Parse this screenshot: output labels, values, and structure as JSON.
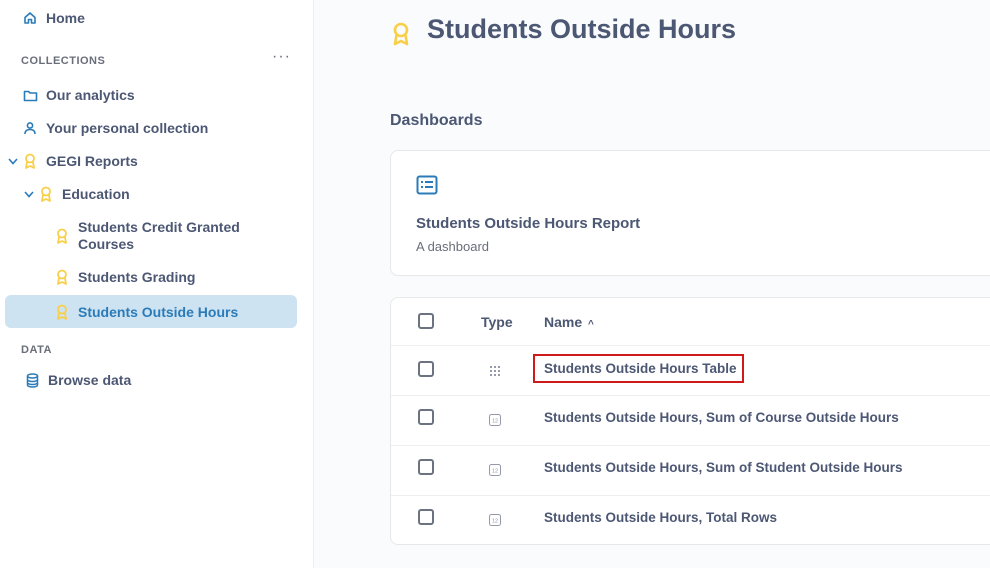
{
  "sidebar": {
    "home": "Home",
    "collections_label": "COLLECTIONS",
    "more": "···",
    "items": [
      {
        "label": "Our analytics"
      },
      {
        "label": "Your personal collection"
      },
      {
        "label": "GEGI Reports"
      },
      {
        "label": "Education"
      },
      {
        "label": "Students Credit Granted Courses"
      },
      {
        "label": "Students Grading"
      },
      {
        "label": "Students Outside Hours"
      }
    ],
    "data_label": "DATA",
    "browse_data": "Browse data"
  },
  "main": {
    "title": "Students Outside Hours",
    "dashboards_heading": "Dashboards",
    "dashboard_card": {
      "title": "Students Outside Hours Report",
      "subtitle": "A dashboard"
    },
    "table": {
      "col_type": "Type",
      "col_name": "Name",
      "sort_indicator": "^",
      "rows": [
        {
          "name": "Students Outside Hours Table",
          "type_icon": "table-grid-icon"
        },
        {
          "name": "Students Outside Hours, Sum of Course Outside Hours",
          "type_icon": "number-scalar-icon"
        },
        {
          "name": "Students Outside Hours, Sum of Student Outside Hours",
          "type_icon": "number-scalar-icon"
        },
        {
          "name": "Students Outside Hours, Total Rows",
          "type_icon": "number-scalar-icon"
        }
      ]
    }
  },
  "colors": {
    "accent": "#2b7bb9",
    "badge": "#f9cf48",
    "active_bg": "#cde3f1",
    "highlight": "#d0191b"
  }
}
